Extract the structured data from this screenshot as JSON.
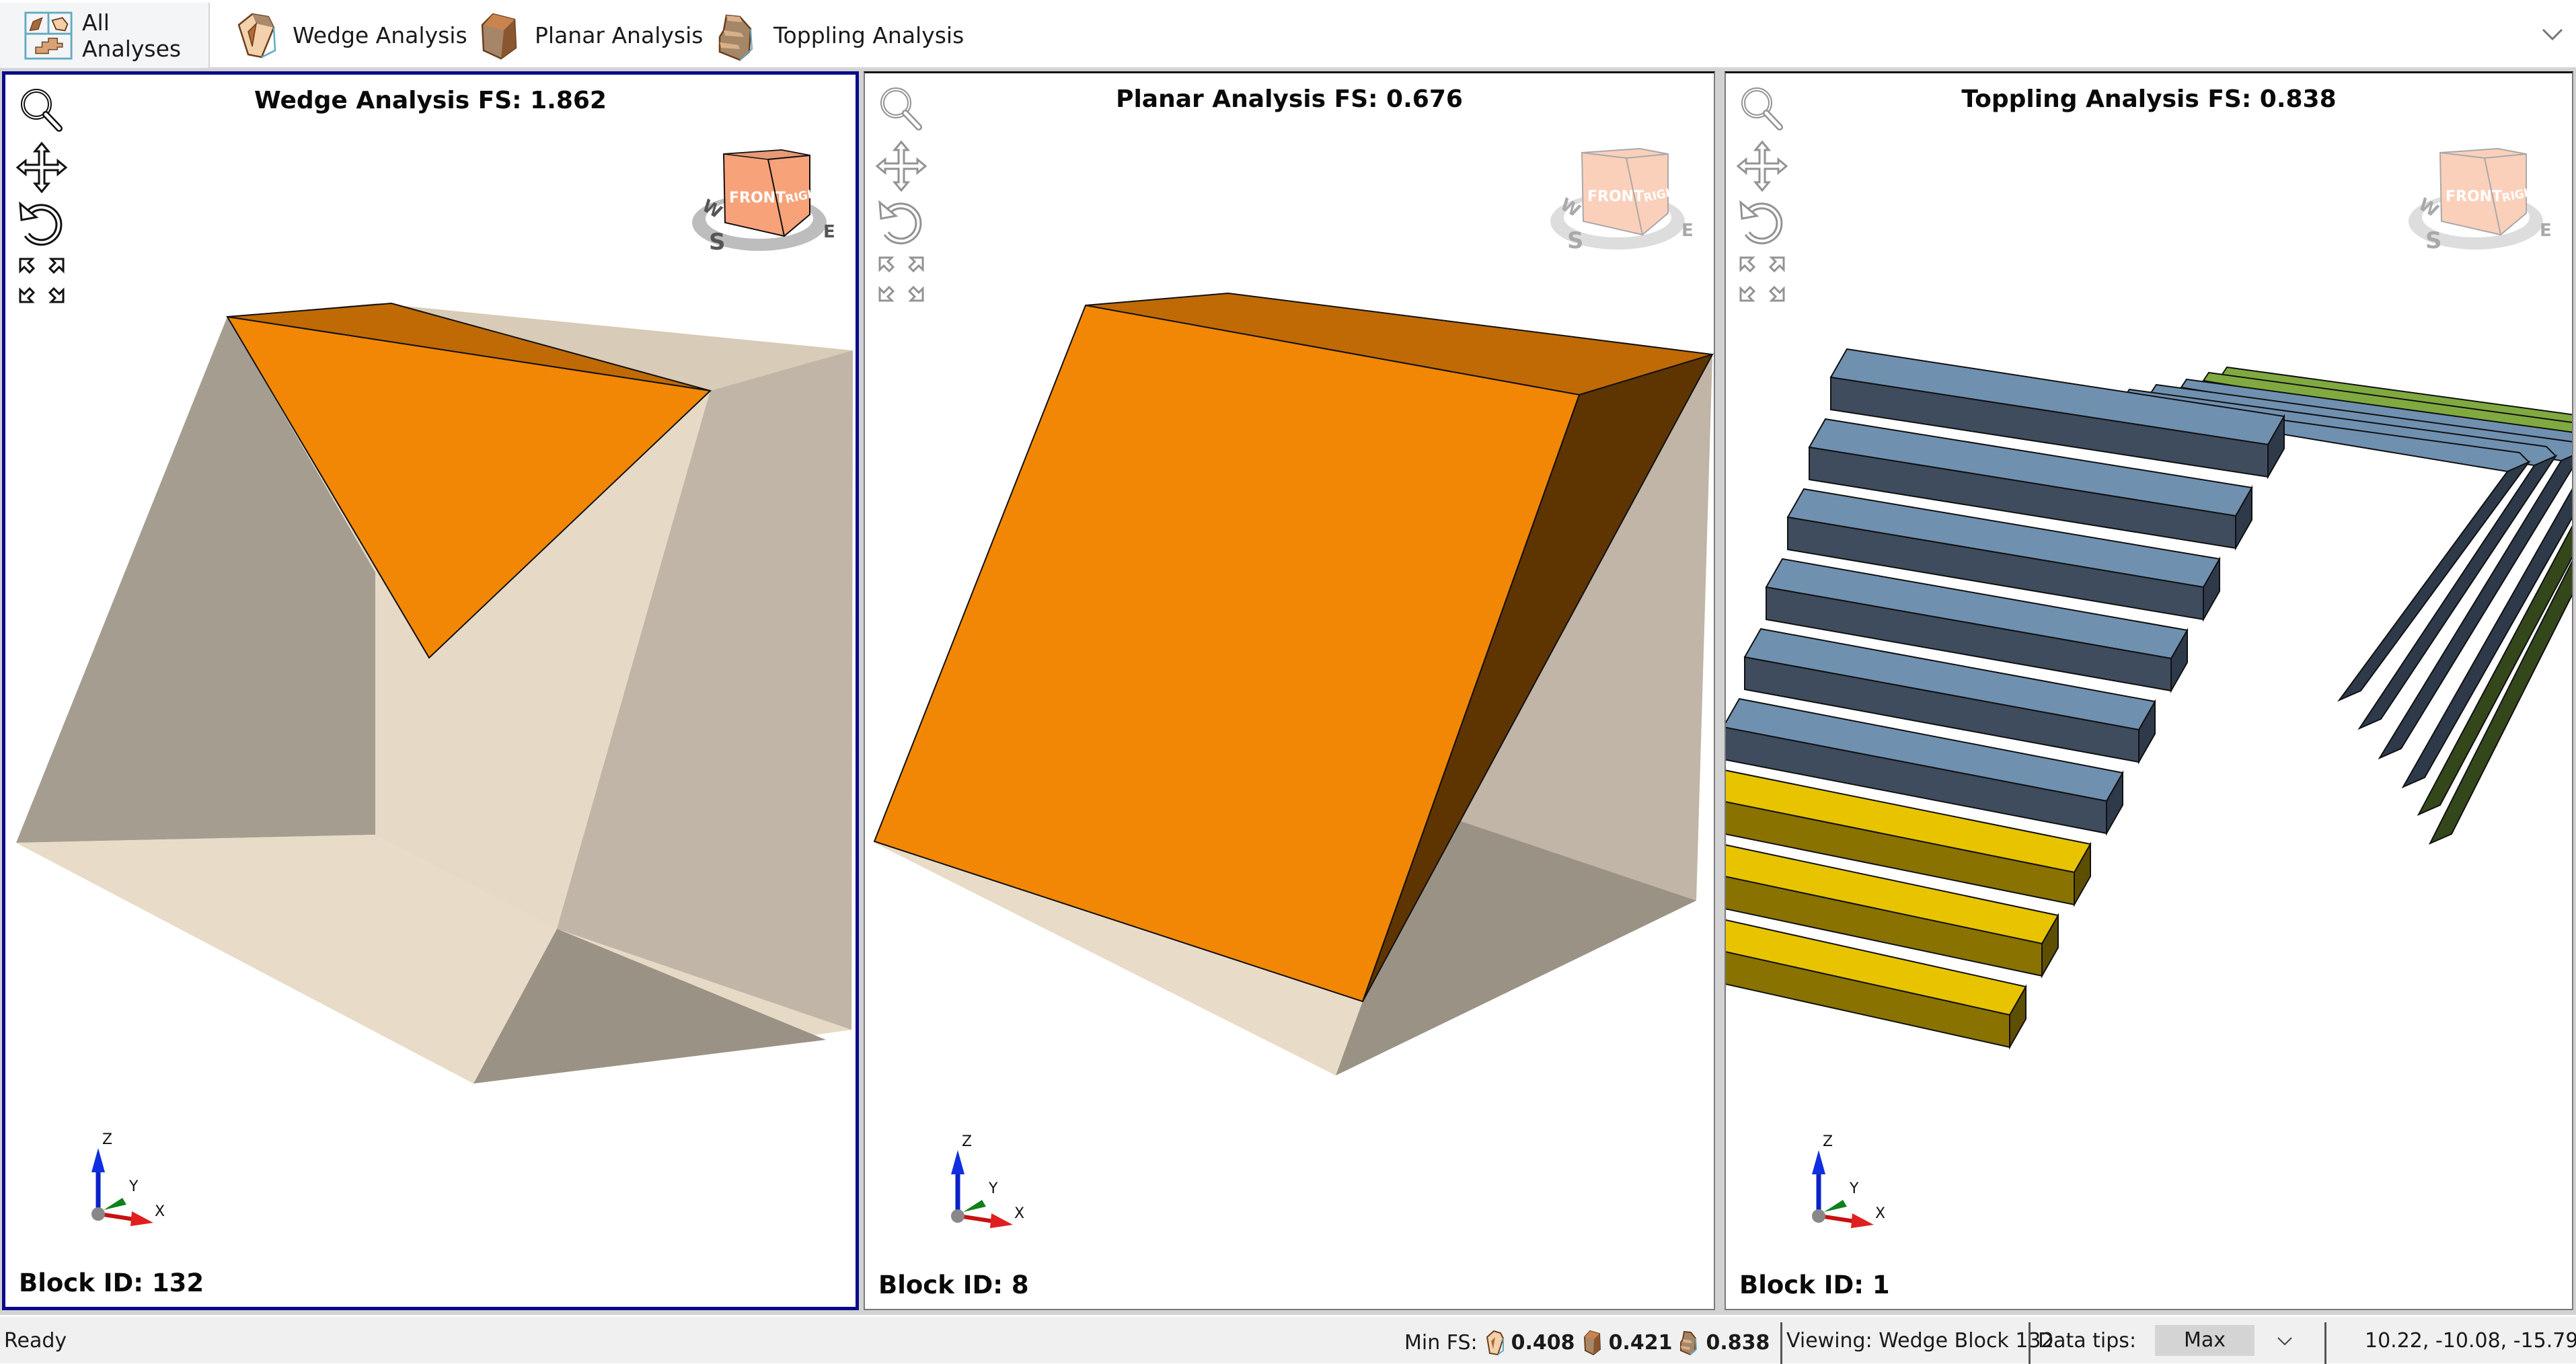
{
  "tabs": [
    {
      "label": "All Analyses",
      "icon": "all-analyses-icon",
      "active": true
    },
    {
      "label": "Wedge Analysis",
      "icon": "wedge-analysis-icon",
      "active": false
    },
    {
      "label": "Planar Analysis",
      "icon": "planar-analysis-icon",
      "active": false
    },
    {
      "label": "Toppling Analysis",
      "icon": "toppling-analysis-icon",
      "active": false
    }
  ],
  "panels": [
    {
      "title": "Wedge Analysis FS: 1.862",
      "block_id": "Block ID: 132",
      "selected": true
    },
    {
      "title": "Planar Analysis FS: 0.676",
      "block_id": "Block ID: 8",
      "selected": false
    },
    {
      "title": "Toppling Analysis FS: 0.838",
      "block_id": "Block ID: 1",
      "selected": false
    }
  ],
  "viewcube": {
    "front": "FRONT",
    "right": "RIGHT",
    "compass": [
      "W",
      "S",
      "E"
    ]
  },
  "triad": {
    "x": "X",
    "y": "Y",
    "z": "Z"
  },
  "colors": {
    "selected_border": "#0a0a8a",
    "block_orange": "#f28705",
    "block_orange_top": "#c06a05",
    "block_orange_side": "#5e3400",
    "rock_light": "#e6dac6",
    "rock_mid": "#c0b5a6",
    "rock_dark": "#9a9285",
    "toppling_blue": "#7090b0",
    "toppling_blue_side": "#2e3a4a",
    "toppling_yellow": "#e8c400",
    "toppling_green": "#80aa40"
  },
  "statusbar": {
    "status": "Ready",
    "min_fs_label": "Min FS:",
    "min_fs_wedge": "0.408",
    "min_fs_planar": "0.421",
    "min_fs_toppling": "0.838",
    "viewing": "Viewing: Wedge Block 132",
    "data_tips_label": "Data tips:",
    "data_tips_value": "Max",
    "coordinates": "10.22, -10.08, -15.79"
  }
}
